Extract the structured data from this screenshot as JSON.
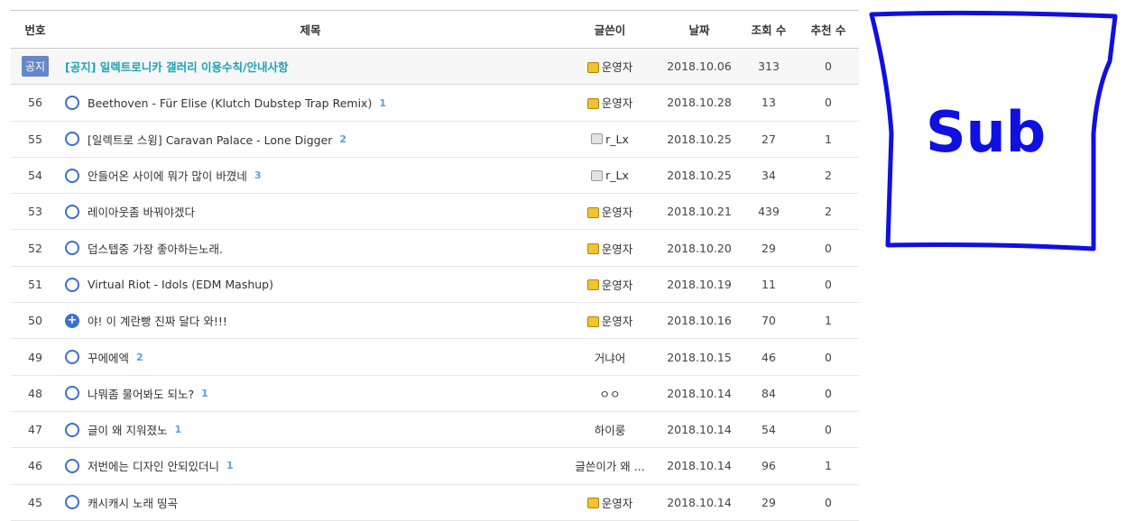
{
  "header": {
    "num": "번호",
    "title": "제목",
    "author": "글쓴이",
    "date": "날짜",
    "views": "조회 수",
    "recommends": "추천 수"
  },
  "notice": {
    "badge": "공지",
    "title": "[공지] 일렉트로니카 갤러리 이용수칙/안내사항",
    "author": "운영자",
    "author_badge": "admin",
    "date": "2018.10.06",
    "views": "313",
    "recommends": "0"
  },
  "posts": [
    {
      "num": "56",
      "icon": "circle",
      "title": "Beethoven - Für Elise (Klutch Dubstep Trap Remix)",
      "comments": "1",
      "author": "운영자",
      "author_badge": "admin",
      "date": "2018.10.28",
      "views": "13",
      "recommends": "0"
    },
    {
      "num": "55",
      "icon": "circle",
      "title": "[일렉트로 스윙] Caravan Palace - Lone Digger",
      "comments": "2",
      "author": "r_Lx",
      "author_badge": "member",
      "date": "2018.10.25",
      "views": "27",
      "recommends": "1"
    },
    {
      "num": "54",
      "icon": "circle",
      "title": "안들어온 사이에 뭐가 많이 바꼈네",
      "comments": "3",
      "author": "r_Lx",
      "author_badge": "member",
      "date": "2018.10.25",
      "views": "34",
      "recommends": "2"
    },
    {
      "num": "53",
      "icon": "circle",
      "title": "레이아웃좀 바꿔야겠다",
      "comments": "",
      "author": "운영자",
      "author_badge": "admin",
      "date": "2018.10.21",
      "views": "439",
      "recommends": "2"
    },
    {
      "num": "52",
      "icon": "circle",
      "title": "덥스텝중 가장 좋아하는노래.",
      "comments": "",
      "author": "운영자",
      "author_badge": "admin",
      "date": "2018.10.20",
      "views": "29",
      "recommends": "0"
    },
    {
      "num": "51",
      "icon": "circle",
      "title": "Virtual Riot - Idols (EDM Mashup)",
      "comments": "",
      "author": "운영자",
      "author_badge": "admin",
      "date": "2018.10.19",
      "views": "11",
      "recommends": "0"
    },
    {
      "num": "50",
      "icon": "plus",
      "title": "야! 이 계란빵 진짜 달다 와!!!",
      "comments": "",
      "author": "운영자",
      "author_badge": "admin",
      "date": "2018.10.16",
      "views": "70",
      "recommends": "1"
    },
    {
      "num": "49",
      "icon": "circle",
      "title": "꾸에에엑",
      "comments": "2",
      "author": "거냐어",
      "author_badge": "",
      "date": "2018.10.15",
      "views": "46",
      "recommends": "0"
    },
    {
      "num": "48",
      "icon": "circle",
      "title": "나뭐좀 물어봐도 되노?",
      "comments": "1",
      "author": "ㅇㅇ",
      "author_badge": "",
      "date": "2018.10.14",
      "views": "84",
      "recommends": "0"
    },
    {
      "num": "47",
      "icon": "circle",
      "title": "글이 왜 지워졌노",
      "comments": "1",
      "author": "하이룽",
      "author_badge": "",
      "date": "2018.10.14",
      "views": "54",
      "recommends": "0"
    },
    {
      "num": "46",
      "icon": "circle",
      "title": "저번에는 디자인 안되있더니",
      "comments": "1",
      "author": "글쓴이가 왜 ...",
      "author_badge": "",
      "date": "2018.10.14",
      "views": "96",
      "recommends": "1"
    },
    {
      "num": "45",
      "icon": "circle",
      "title": "캐시캐시 노래 띵곡",
      "comments": "",
      "author": "운영자",
      "author_badge": "admin",
      "date": "2018.10.14",
      "views": "29",
      "recommends": "0"
    }
  ],
  "sub_panel": {
    "label": "Sub"
  }
}
